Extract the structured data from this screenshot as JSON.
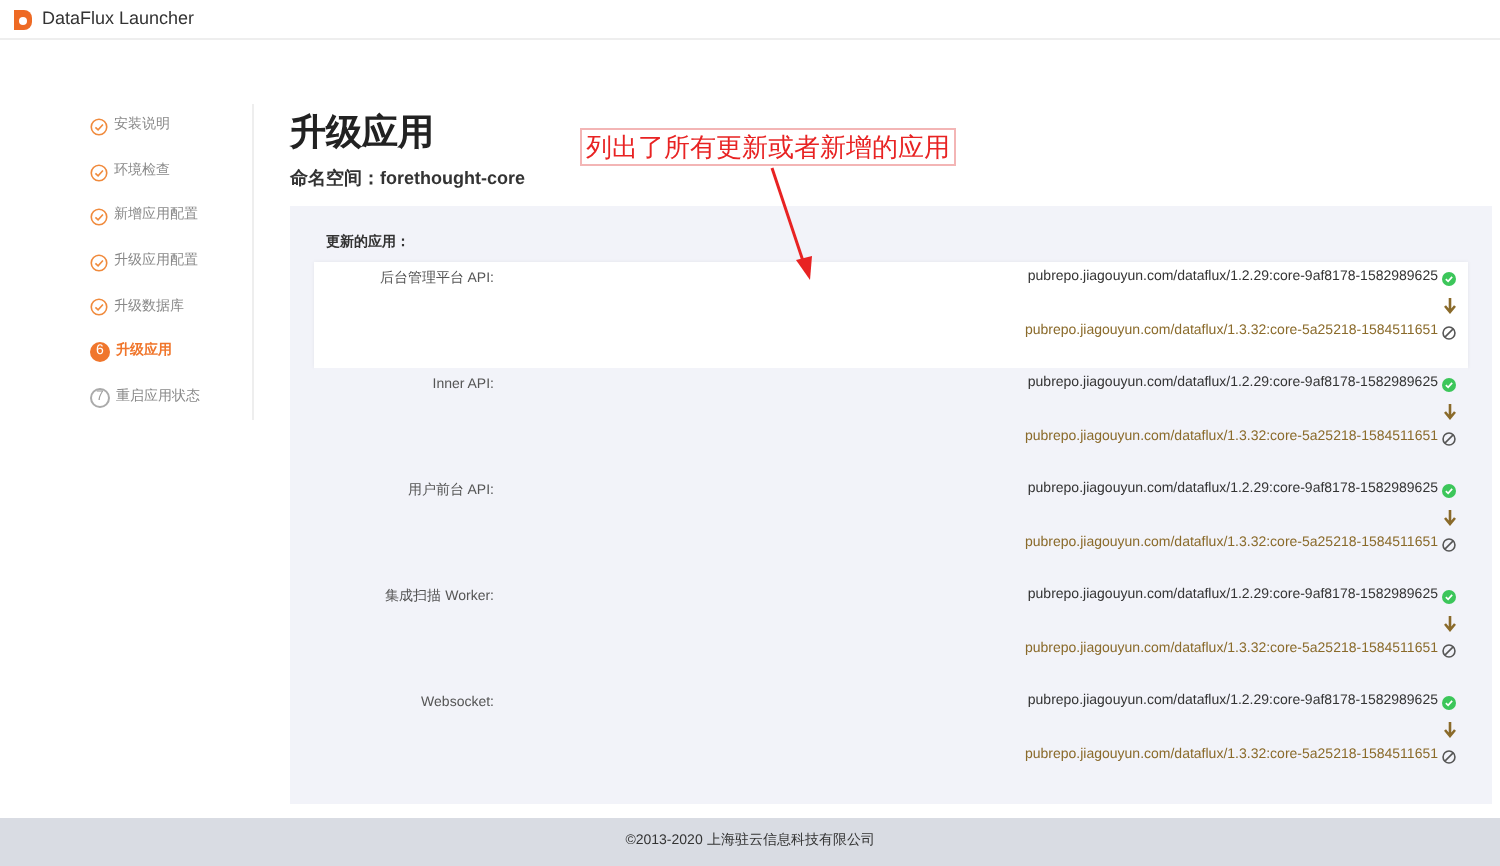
{
  "app": {
    "title": "DataFlux Launcher"
  },
  "steps": [
    {
      "label": "安装说明",
      "kind": "done"
    },
    {
      "label": "环境检查",
      "kind": "done"
    },
    {
      "label": "新增应用配置",
      "kind": "done"
    },
    {
      "label": "升级应用配置",
      "kind": "done"
    },
    {
      "label": "升级数据库",
      "kind": "done"
    },
    {
      "label": "升级应用",
      "kind": "current",
      "number": "6"
    },
    {
      "label": "重启应用状态",
      "kind": "todo",
      "number": "7"
    }
  ],
  "page": {
    "title": "升级应用",
    "namespace": "命名空间：forethought-core",
    "section_label": "更新的应用：",
    "apps": [
      {
        "name": "后台管理平台 API:",
        "current": "pubrepo.jiagouyun.com/dataflux/1.2.29:core-9af8178-1582989625",
        "target": "pubrepo.jiagouyun.com/dataflux/1.3.32:core-5a25218-1584511651",
        "selected": true
      },
      {
        "name": "Inner API:",
        "current": "pubrepo.jiagouyun.com/dataflux/1.2.29:core-9af8178-1582989625",
        "target": "pubrepo.jiagouyun.com/dataflux/1.3.32:core-5a25218-1584511651",
        "selected": false
      },
      {
        "name": "用户前台 API:",
        "current": "pubrepo.jiagouyun.com/dataflux/1.2.29:core-9af8178-1582989625",
        "target": "pubrepo.jiagouyun.com/dataflux/1.3.32:core-5a25218-1584511651",
        "selected": false
      },
      {
        "name": "集成扫描 Worker:",
        "current": "pubrepo.jiagouyun.com/dataflux/1.2.29:core-9af8178-1582989625",
        "target": "pubrepo.jiagouyun.com/dataflux/1.3.32:core-5a25218-1584511651",
        "selected": false
      },
      {
        "name": "Websocket:",
        "current": "pubrepo.jiagouyun.com/dataflux/1.2.29:core-9af8178-1582989625",
        "target": "pubrepo.jiagouyun.com/dataflux/1.3.32:core-5a25218-1584511651",
        "selected": false
      }
    ]
  },
  "annotation": {
    "text": "列出了所有更新或者新增的应用"
  },
  "footer": {
    "text": "©2013-2020 上海驻云信息科技有限公司"
  }
}
